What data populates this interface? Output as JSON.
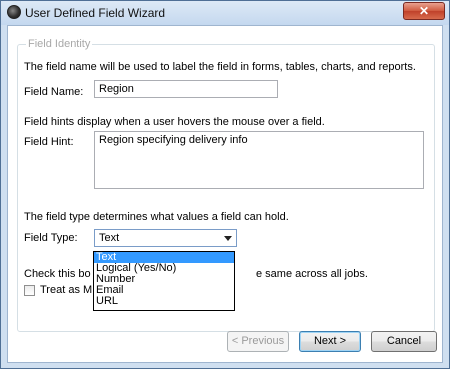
{
  "window": {
    "title": "User Defined Field Wizard",
    "close_glyph": "✕"
  },
  "group": {
    "legend": "Field Identity"
  },
  "field_name": {
    "description": "The field name will be used to label the field in forms, tables, charts, and reports.",
    "label": "Field Name:",
    "value": "Region"
  },
  "field_hint": {
    "description": "Field hints display when a user hovers the mouse over a field.",
    "label": "Field Hint:",
    "value": "Region specifying delivery info"
  },
  "field_type": {
    "description": "The field type determines what values a field can hold.",
    "label": "Field Type:",
    "selected": "Text",
    "options": [
      "Text",
      "Logical (Yes/No)",
      "Number",
      "Email",
      "URL"
    ]
  },
  "master": {
    "description_left": "Check this bo",
    "description_right": "e same across all jobs.",
    "checkbox_label": "Treat as M",
    "checked": false
  },
  "buttons": {
    "previous": "< Previous",
    "next": "Next >",
    "cancel": "Cancel"
  },
  "icons": {
    "app": "app-icon",
    "close": "close-icon",
    "dropdown": "chevron-down-icon"
  },
  "colors": {
    "selection": "#3399ff",
    "title_bg": "#cfdff0",
    "close_red": "#c0412a"
  }
}
